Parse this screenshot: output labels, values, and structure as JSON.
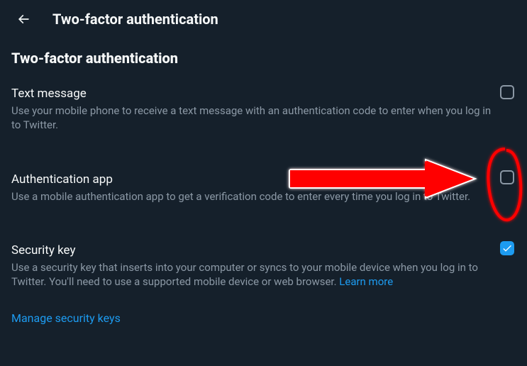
{
  "header": {
    "title": "Two-factor authentication"
  },
  "section": {
    "title": "Two-factor authentication"
  },
  "options": {
    "text_message": {
      "title": "Text message",
      "desc": "Use your mobile phone to receive a text message with an authentication code to enter when you log in to Twitter.",
      "checked": false
    },
    "auth_app": {
      "title": "Authentication app",
      "desc": "Use a mobile authentication app to get a verification code to enter every time you log in to Twitter.",
      "checked": false
    },
    "security_key": {
      "title": "Security key",
      "desc_part1": "Use a security key that inserts into your computer or syncs to your mobile device when you log in to Twitter. You'll need to use a supported mobile device or web browser. ",
      "learn_more": "Learn more",
      "checked": true
    }
  },
  "manage_link": "Manage security keys"
}
